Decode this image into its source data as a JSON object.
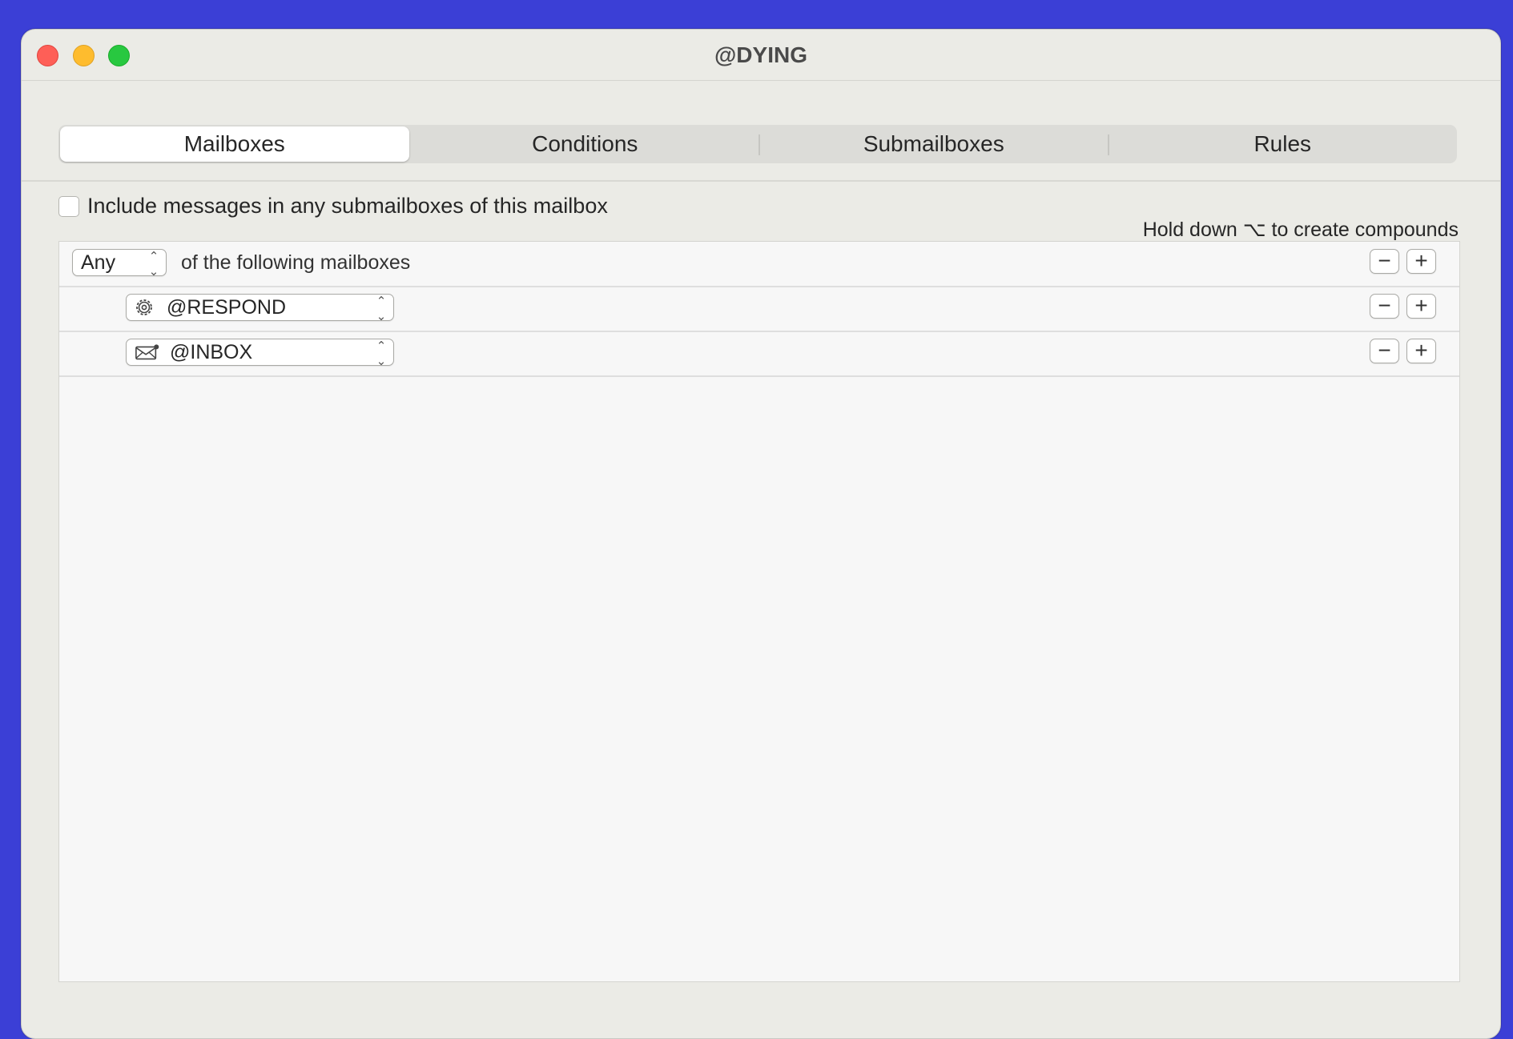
{
  "window": {
    "title": "@DYING"
  },
  "tabs": [
    {
      "label": "Mailboxes",
      "active": true
    },
    {
      "label": "Conditions",
      "active": false
    },
    {
      "label": "Submailboxes",
      "active": false
    },
    {
      "label": "Rules",
      "active": false
    }
  ],
  "include_submailboxes": {
    "label": "Include messages in any submailboxes of this mailbox",
    "checked": false
  },
  "hint": "Hold down ⌥ to create compounds",
  "criteria": {
    "match_selector": "Any",
    "match_text": "of the following mailboxes",
    "mailboxes": [
      {
        "name": "@RESPOND",
        "icon": "gear-icon"
      },
      {
        "name": "@INBOX",
        "icon": "mailbox-envelope-icon"
      }
    ]
  },
  "buttons": {
    "remove": "−",
    "add": "+"
  }
}
